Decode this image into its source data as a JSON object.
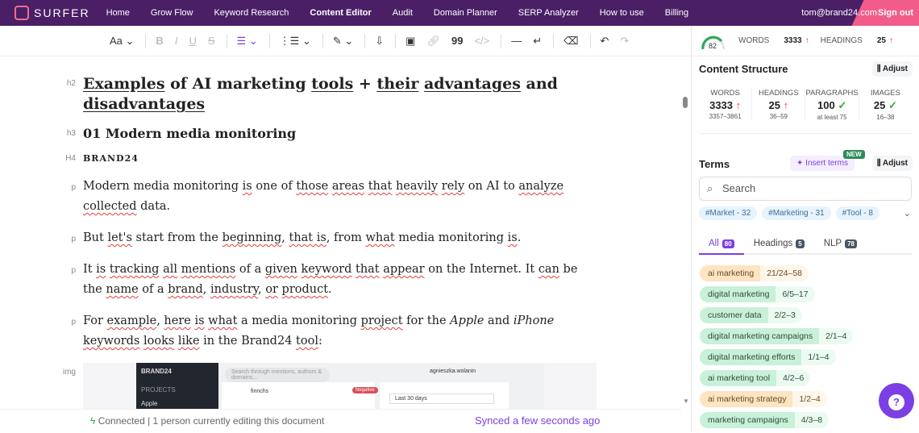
{
  "nav": {
    "logo": "SURFER",
    "items": [
      "Home",
      "Grow Flow",
      "Keyword Research",
      "Content Editor",
      "Audit",
      "Domain Planner",
      "SERP Analyzer",
      "How to use",
      "Billing"
    ],
    "active": "Content Editor",
    "user": "tom@brand24.com",
    "signout": "Sign out"
  },
  "toolbar": {
    "font": "Aa"
  },
  "editor": {
    "tags": {
      "h2": "h2",
      "h3": "h3",
      "h4": "H4",
      "p": "p",
      "img": "img"
    },
    "h2": [
      {
        "t": "Examples",
        "u": "ul"
      },
      {
        "t": " of AI marketing "
      },
      {
        "t": "tools",
        "u": "ul"
      },
      {
        "t": " + "
      },
      {
        "t": "their",
        "u": "ul"
      },
      {
        "t": " "
      },
      {
        "t": "advantages",
        "u": "ul"
      },
      {
        "t": " and "
      },
      {
        "t": "disadvantages",
        "u": "ul"
      }
    ],
    "h3": "01 Modern media monitoring",
    "h4": "BRAND24",
    "paragraphs": [
      [
        {
          "t": "Modern media monitoring "
        },
        {
          "t": "is",
          "u": "sq"
        },
        {
          "t": " one of "
        },
        {
          "t": "those",
          "u": "sq"
        },
        {
          "t": " "
        },
        {
          "t": "areas",
          "u": "sq"
        },
        {
          "t": " "
        },
        {
          "t": "that",
          "u": "sq"
        },
        {
          "t": " "
        },
        {
          "t": "heavily",
          "u": "sq"
        },
        {
          "t": " "
        },
        {
          "t": "rely",
          "u": "sq"
        },
        {
          "t": " on AI to "
        },
        {
          "t": "analyze",
          "u": "sq"
        },
        {
          "t": " "
        },
        {
          "t": "collected",
          "u": "sq"
        },
        {
          "t": " data."
        }
      ],
      [
        {
          "t": "But "
        },
        {
          "t": "let's",
          "u": "sq"
        },
        {
          "t": " start from the "
        },
        {
          "t": "beginning",
          "u": "sq"
        },
        {
          "t": ", "
        },
        {
          "t": "that is",
          "u": "sq"
        },
        {
          "t": ", from "
        },
        {
          "t": "what",
          "u": "sq"
        },
        {
          "t": " media monitoring "
        },
        {
          "t": "is",
          "u": "sq"
        },
        {
          "t": "."
        }
      ],
      [
        {
          "t": "It "
        },
        {
          "t": "is",
          "u": "sq"
        },
        {
          "t": " "
        },
        {
          "t": "tracking",
          "u": "sq"
        },
        {
          "t": " "
        },
        {
          "t": "all",
          "u": "sq"
        },
        {
          "t": " "
        },
        {
          "t": "mentions",
          "u": "sq"
        },
        {
          "t": " of a "
        },
        {
          "t": "given",
          "u": "sq"
        },
        {
          "t": " "
        },
        {
          "t": "keyword",
          "u": "sq"
        },
        {
          "t": " "
        },
        {
          "t": "that",
          "u": "sq"
        },
        {
          "t": " "
        },
        {
          "t": "appear",
          "u": "sq"
        },
        {
          "t": " on the Internet. It "
        },
        {
          "t": "can",
          "u": "sq"
        },
        {
          "t": " be the "
        },
        {
          "t": "name",
          "u": "sq"
        },
        {
          "t": " of a "
        },
        {
          "t": "brand",
          "u": "sq"
        },
        {
          "t": ", "
        },
        {
          "t": "industry",
          "u": "sq"
        },
        {
          "t": ", "
        },
        {
          "t": "or",
          "u": "sq"
        },
        {
          "t": " "
        },
        {
          "t": "product",
          "u": "sq"
        },
        {
          "t": "."
        }
      ],
      [
        {
          "t": "For "
        },
        {
          "t": "example",
          "u": "sq"
        },
        {
          "t": ", "
        },
        {
          "t": "here",
          "u": "sq"
        },
        {
          "t": " "
        },
        {
          "t": "is",
          "u": "sq"
        },
        {
          "t": " "
        },
        {
          "t": "what",
          "u": "sq"
        },
        {
          "t": " a media monitoring "
        },
        {
          "t": "project",
          "u": "sq"
        },
        {
          "t": " for the "
        },
        {
          "t": "Apple",
          "i": true
        },
        {
          "t": " and "
        },
        {
          "t": "iPhone",
          "i": true
        },
        {
          "t": " "
        },
        {
          "t": "keywords",
          "u": "sq"
        },
        {
          "t": " "
        },
        {
          "t": "looks",
          "u": "sq"
        },
        {
          "t": " "
        },
        {
          "t": "like",
          "u": "sq"
        },
        {
          "t": " in the Brand24 "
        },
        {
          "t": "tool",
          "u": "sq"
        },
        {
          "t": ":"
        }
      ]
    ],
    "screenshot": {
      "brand": "BRAND24",
      "projects": "PROJECTS",
      "project": "Apple",
      "search": "Search through mentions, authors & domains...",
      "user": "agnieszka.wolanin",
      "author": "finnchs",
      "sentiment": "Negative",
      "range": "Last 30 days"
    }
  },
  "footer": {
    "connected": "Connected | 1 person currently editing this document",
    "synced": "Synced a few seconds ago"
  },
  "panel": {
    "score": "82",
    "words_label": "WORDS",
    "words": "3333",
    "headings_label": "HEADINGS",
    "headings": "25",
    "structure": {
      "title": "Content Structure",
      "adjust": "Adjust",
      "stats": [
        {
          "label": "WORDS",
          "value": "3333",
          "mark": "↑",
          "range": "3357–3861",
          "status": "red"
        },
        {
          "label": "HEADINGS",
          "value": "25",
          "mark": "↑",
          "range": "36–59",
          "status": "red"
        },
        {
          "label": "PARAGRAPHS",
          "value": "100",
          "mark": "✓",
          "range": "at least 75",
          "status": "grn"
        },
        {
          "label": "IMAGES",
          "value": "25",
          "mark": "✓",
          "range": "16–38",
          "status": "grn"
        }
      ]
    },
    "terms": {
      "title": "Terms",
      "insert": "Insert terms",
      "new": "NEW",
      "adjust": "Adjust",
      "search_placeholder": "Search",
      "chips": [
        "#Market - 32",
        "#Marketing - 31",
        "#Tool - 8"
      ],
      "tabs": [
        {
          "label": "All",
          "count": "80"
        },
        {
          "label": "Headings",
          "count": "5"
        },
        {
          "label": "NLP",
          "count": "78"
        }
      ],
      "list": [
        {
          "name": "ai marketing",
          "count": "21/24–58",
          "color": "o"
        },
        {
          "name": "digital marketing",
          "count": "6/5–17",
          "color": "g"
        },
        {
          "name": "customer data",
          "count": "2/2–3",
          "color": "g"
        },
        {
          "name": "digital marketing campaigns",
          "count": "2/1–4",
          "color": "g"
        },
        {
          "name": "digital marketing efforts",
          "count": "1/1–4",
          "color": "g"
        },
        {
          "name": "ai marketing tool",
          "count": "4/2–6",
          "color": "g"
        },
        {
          "name": "ai marketing strategy",
          "count": "1/2–4",
          "color": "o"
        },
        {
          "name": "marketing campaigns",
          "count": "4/3–8",
          "color": "g"
        }
      ]
    }
  },
  "help": "?"
}
